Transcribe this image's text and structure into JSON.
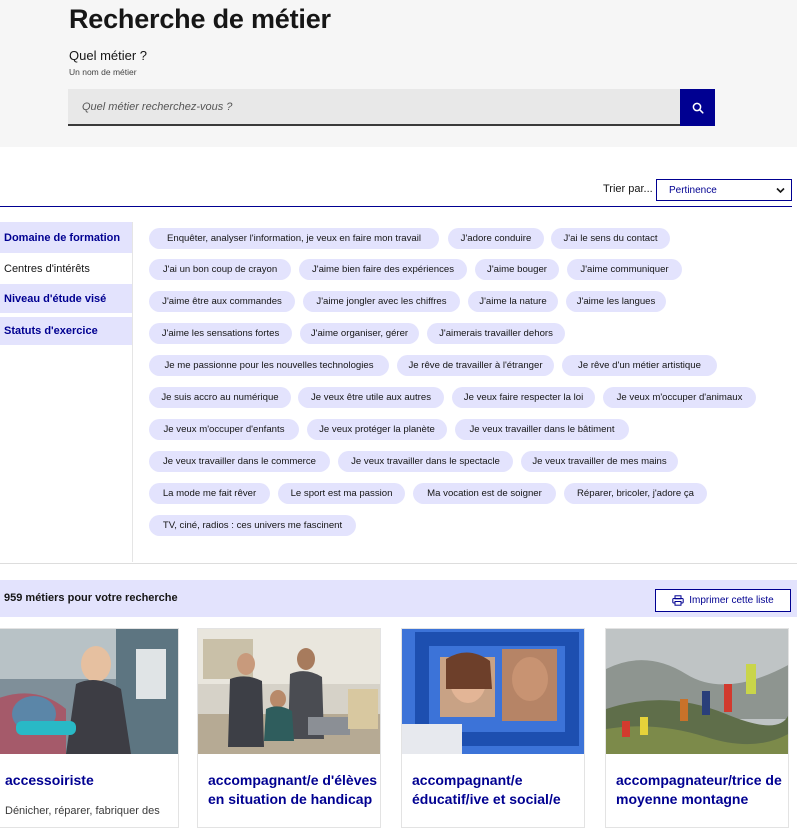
{
  "header": {
    "title": "Recherche de métier",
    "field_label": "Quel métier ?",
    "field_hint": "Un nom de métier",
    "search_placeholder": "Quel métier recherchez-vous ?",
    "search_icon": "search-icon"
  },
  "sort": {
    "label": "Trier par...",
    "selected": "Pertinence"
  },
  "sidebar": {
    "items": [
      {
        "label": "Domaine de formation"
      },
      {
        "label": "Centres d'intérêts"
      },
      {
        "label": "Niveau d'étude visé"
      },
      {
        "label": "Statuts d'exercice"
      }
    ]
  },
  "tags": [
    "Enquêter, analyser l'information, je veux en faire mon travail",
    "J'adore conduire",
    "J'ai le sens du contact",
    "J'ai un bon coup de crayon",
    "J'aime bien faire des expériences",
    "J'aime bouger",
    "J'aime communiquer",
    "J'aime être aux commandes",
    "J'aime jongler avec les chiffres",
    "J'aime la nature",
    "J'aime les langues",
    "J'aime les sensations fortes",
    "J'aime organiser, gérer",
    "J'aimerais travailler dehors",
    "Je me passionne pour les nouvelles technologies",
    "Je rêve de travailler à l'étranger",
    "Je rêve d'un métier artistique",
    "Je suis accro au numérique",
    "Je veux être utile aux autres",
    "Je veux faire respecter la loi",
    "Je veux m'occuper d'animaux",
    "Je veux m'occuper d'enfants",
    "Je veux protéger la planète",
    "Je veux travailler dans le bâtiment",
    "Je veux travailler dans le commerce",
    "Je veux travailler dans le spectacle",
    "Je veux travailler de mes mains",
    "La mode me fait rêver",
    "Le sport est ma passion",
    "Ma vocation est de soigner",
    "Réparer, bricoler, j'adore ça",
    "TV, ciné, radios : ces univers me fascinent"
  ],
  "results": {
    "count_text": "959 métiers pour votre recherche",
    "print_label": "Imprimer cette liste",
    "print_icon": "printer-icon"
  },
  "cards": [
    {
      "title": "accessoiriste",
      "desc": "Dénicher, réparer, fabriquer des"
    },
    {
      "title": "accompagnant/e d'élèves en situation de handicap",
      "desc": ""
    },
    {
      "title": "accompagnant/e éducatif/ive et social/e",
      "desc": ""
    },
    {
      "title": "accompagnateur/trice de moyenne montagne",
      "desc": ""
    }
  ],
  "colors": {
    "primary": "#000091",
    "tag_bg": "#e3e3fd",
    "header_bg": "#f6f6f6"
  }
}
